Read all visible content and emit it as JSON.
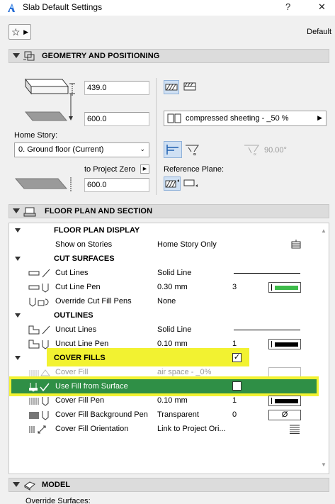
{
  "window": {
    "title": "Slab Default Settings",
    "help": "?",
    "close": "✕",
    "mode": "Default"
  },
  "sections": {
    "geometry": "GEOMETRY AND POSITIONING",
    "floorplan": "FLOOR PLAN AND SECTION",
    "model": "MODEL"
  },
  "geometry": {
    "thickness": "439.0",
    "offset": "600.0",
    "home_story_label": "Home Story:",
    "home_story_value": "0. Ground floor (Current)",
    "to_project_zero_label": "to Project Zero",
    "project_zero_value": "600.0",
    "composite_value": "compressed sheeting - _50 %",
    "angle_value": "90.00°",
    "reference_plane_label": "Reference Plane:"
  },
  "tree": {
    "rows": [
      {
        "type": "header",
        "label": "FLOOR PLAN DISPLAY"
      },
      {
        "type": "item",
        "name": "Show on Stories",
        "value": "Home Story Only"
      },
      {
        "type": "header",
        "label": "CUT SURFACES"
      },
      {
        "type": "item",
        "name": "Cut Lines",
        "value": "Solid Line"
      },
      {
        "type": "item",
        "name": "Cut Line Pen",
        "value": "0.30 mm",
        "num": "3"
      },
      {
        "type": "item",
        "name": "Override Cut Fill Pens",
        "value": "None"
      },
      {
        "type": "header",
        "label": "OUTLINES"
      },
      {
        "type": "item",
        "name": "Uncut Lines",
        "value": "Solid Line"
      },
      {
        "type": "item",
        "name": "Uncut Line Pen",
        "value": "0.10 mm",
        "num": "1"
      },
      {
        "type": "header",
        "label": "COVER FILLS"
      },
      {
        "type": "item",
        "name": "Cover Fill",
        "value": "air space - _0%"
      },
      {
        "type": "item",
        "name": "Use Fill from Surface"
      },
      {
        "type": "item",
        "name": "Cover Fill Pen",
        "value": "0.10 mm",
        "num": "1"
      },
      {
        "type": "item",
        "name": "Cover Fill Background Pen",
        "value": "Transparent",
        "num": "0",
        "pen_symbol": "Ø"
      },
      {
        "type": "item",
        "name": "Cover Fill Orientation",
        "value": "Link to Project Ori..."
      }
    ]
  },
  "model": {
    "override_surfaces_label": "Override Surfaces:"
  },
  "colors": {
    "highlight_yellow": "#f2f231",
    "selected_green": "#2f8f46",
    "pen_green": "#3dbb4a"
  }
}
